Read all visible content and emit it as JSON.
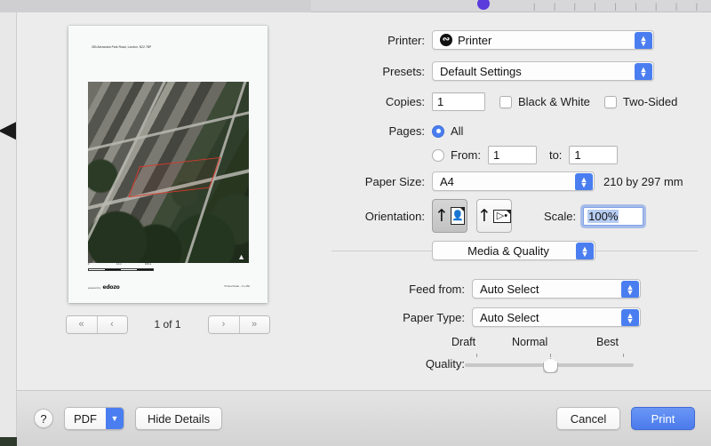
{
  "dialog": {
    "preview": {
      "document": {
        "address": "283 Alexandra Park Road, London, N22 7BP",
        "map_type": "aerial-satellite",
        "scalebar": {
          "start": "0",
          "mid": "12  m",
          "end": "100 m"
        },
        "footer_prefix": "powered by",
        "footer_logo": "edozo",
        "footer_right": "Printed Scale - 1:1,250"
      },
      "pager": {
        "first_label": "«",
        "prev_label": "‹",
        "page_label": "1 of 1",
        "next_label": "›",
        "last_label": "»"
      }
    },
    "settings": {
      "printer": {
        "label": "Printer:",
        "value": "Printer",
        "icon": "printer-status-icon"
      },
      "presets": {
        "label": "Presets:",
        "value": "Default Settings"
      },
      "copies": {
        "label": "Copies:",
        "value": "1"
      },
      "black_white": {
        "label": "Black & White",
        "checked": false
      },
      "two_sided": {
        "label": "Two-Sided",
        "checked": false
      },
      "pages": {
        "label": "Pages:",
        "all_label": "All",
        "all_selected": true,
        "from_label": "From:",
        "from_value": "1",
        "to_label": "to:",
        "to_value": "1",
        "range_selected": false
      },
      "paper_size": {
        "label": "Paper Size:",
        "value": "A4",
        "dimensions": "210 by 297 mm"
      },
      "orientation": {
        "label": "Orientation:",
        "portrait_selected": true,
        "landscape_selected": false
      },
      "scale": {
        "label": "Scale:",
        "value": "100%",
        "focused": true
      },
      "section": {
        "value": "Media & Quality"
      },
      "feed_from": {
        "label": "Feed from:",
        "value": "Auto Select"
      },
      "paper_type": {
        "label": "Paper Type:",
        "value": "Auto Select"
      },
      "quality": {
        "label": "Quality:",
        "min_label": "Draft",
        "mid_label": "Normal",
        "max_label": "Best",
        "value": "Normal",
        "position_percent": 50
      }
    },
    "footer": {
      "help_label": "?",
      "pdf_label": "PDF",
      "pdf_arrow": "⌄",
      "hide_details_label": "Hide Details",
      "cancel_label": "Cancel",
      "print_label": "Print"
    }
  },
  "colors": {
    "accent_blue": "#4a7ef0",
    "primary_button": "#4b7bec",
    "sheet_bg": "#ececec",
    "plot_outline": "#d83a2a"
  }
}
